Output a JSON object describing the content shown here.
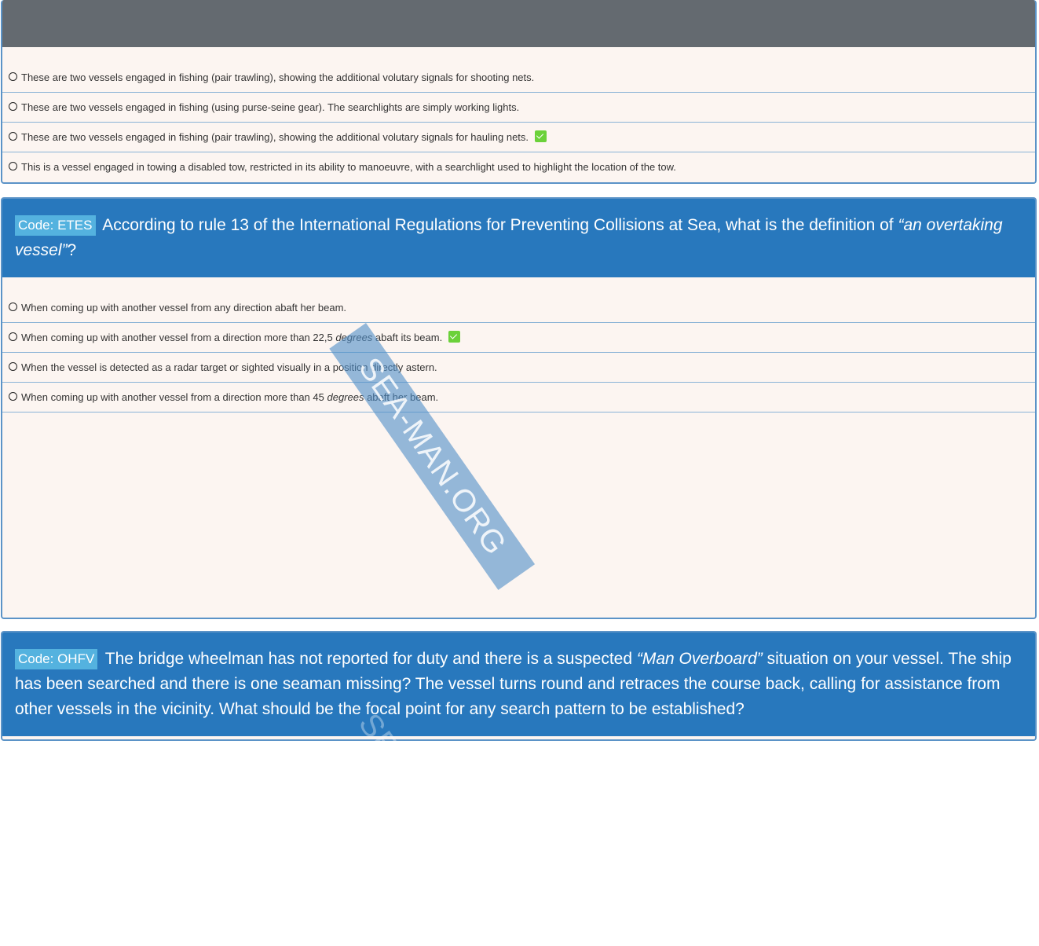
{
  "questions": [
    {
      "options": [
        {
          "text": "These are two vessels engaged in fishing (pair trawling), showing the additional volutary signals for shooting nets.",
          "correct": false
        },
        {
          "text": "These are two vessels engaged in fishing (using purse-seine gear). The searchlights are simply working lights.",
          "correct": false
        },
        {
          "text": "These are two vessels engaged in fishing (pair trawling), showing the additional volutary signals for hauling nets.",
          "correct": true
        },
        {
          "text": "This is a vessel engaged in towing a disabled tow, restricted in its ability to manoeuvre, with a searchlight used to highlight the location of the tow.",
          "correct": false
        }
      ]
    },
    {
      "code": "Code: ETES",
      "text_before": "According to rule 13 of the International Regulations for Preventing Collisions at Sea, what is the definition of ",
      "text_italic": "“an overtaking vessel”",
      "text_after": "?",
      "options": [
        {
          "pre": "When coming up with another vessel from any direction abaft her beam.",
          "em": "",
          "post": "",
          "correct": false
        },
        {
          "pre": "When coming up with another vessel from a direction more than 22,5 ",
          "em": "degrees",
          "post": " abaft its beam.",
          "correct": true
        },
        {
          "pre": "When the vessel is detected as a radar target or sighted visually in a position directly astern.",
          "em": "",
          "post": "",
          "correct": false
        },
        {
          "pre": "When coming up with another vessel from a direction more than 45 ",
          "em": "degrees",
          "post": " abaft her beam.",
          "correct": false
        }
      ]
    },
    {
      "code": "Code: OHFV",
      "text_before": "The bridge wheelman has not reported for duty and there is a suspected ",
      "text_italic": "“Man Overboard”",
      "text_after": " situation on your vessel. The ship has been searched and there is one seaman missing? The vessel turns round and retraces the course back, calling for assistance from other vessels in the vicinity. What should be the focal point for any search pattern to be established?"
    }
  ],
  "watermark": "SEA-MAN.ORG",
  "colors": {
    "header_blue": "#2878bd",
    "badge_blue": "#54b2df",
    "correct_green": "#6bd13a",
    "card_bg": "#fcf5f1",
    "grey_header": "#646a70"
  }
}
